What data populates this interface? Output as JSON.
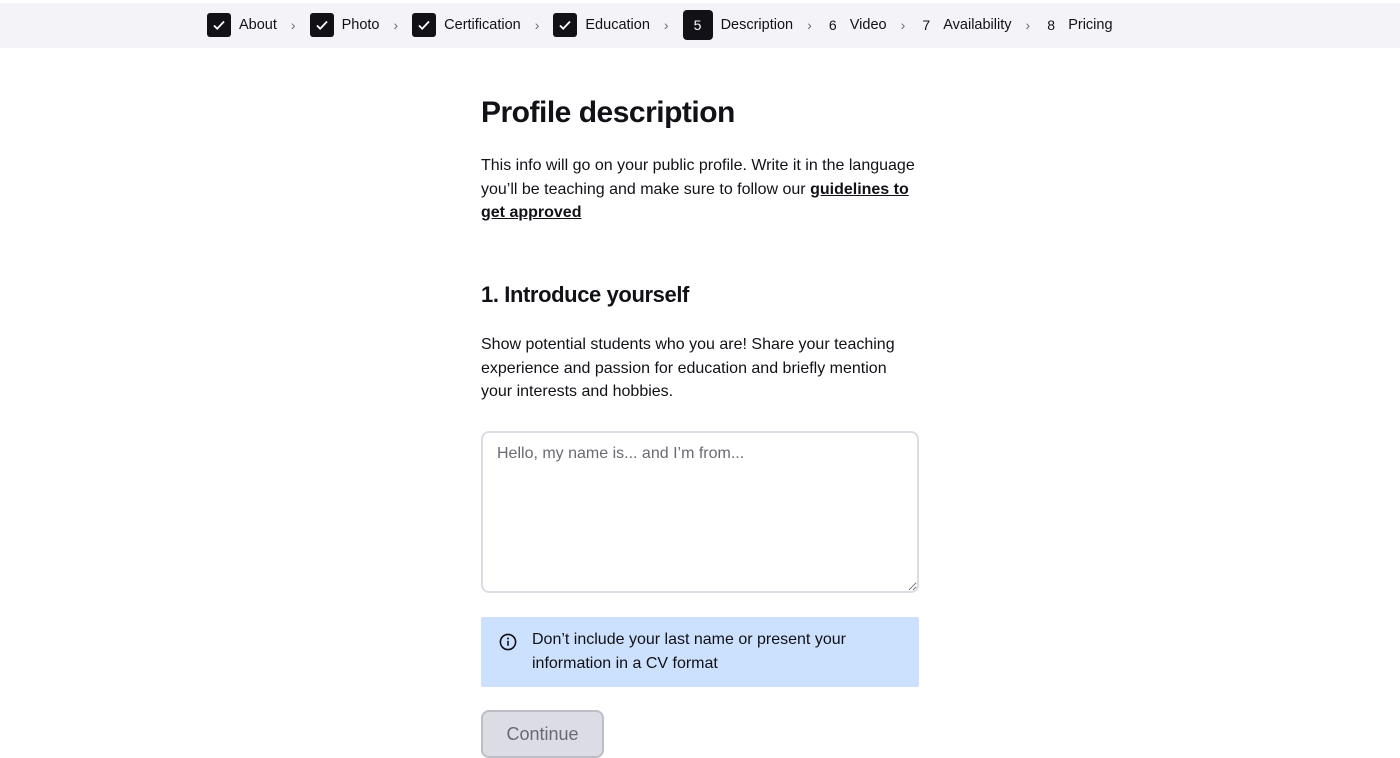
{
  "stepper": {
    "steps": [
      {
        "label": "About",
        "status": "done"
      },
      {
        "label": "Photo",
        "status": "done"
      },
      {
        "label": "Certification",
        "status": "done"
      },
      {
        "label": "Education",
        "status": "done"
      },
      {
        "number": "5",
        "label": "Description",
        "status": "active"
      },
      {
        "number": "6",
        "label": "Video",
        "status": "upcoming"
      },
      {
        "number": "7",
        "label": "Availability",
        "status": "upcoming"
      },
      {
        "number": "8",
        "label": "Pricing",
        "status": "upcoming"
      }
    ]
  },
  "page": {
    "title": "Profile description",
    "intro_text": "This info will go on your public profile. Write it in the language you’ll be teaching and make sure to follow our ",
    "intro_link": "guidelines to get approved",
    "section_title": "1. Introduce yourself",
    "section_text": "Show potential students who you are! Share your teaching experience and passion for education and briefly mention your interests and hobbies.",
    "textarea": {
      "value": "",
      "placeholder": "Hello, my name is... and I’m from..."
    },
    "note": "Don’t include your last name or present your information in a CV format",
    "continue_label": "Continue"
  },
  "colors": {
    "note_bg": "#cce1fd",
    "dark": "#121117",
    "topbar_bg": "#f4f4f8"
  }
}
